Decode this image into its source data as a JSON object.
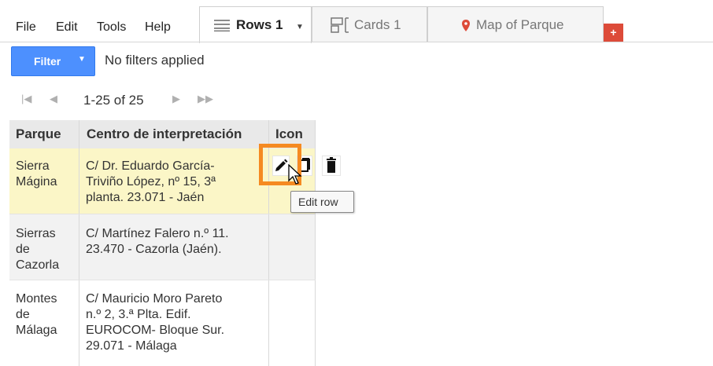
{
  "menu": {
    "file": "File",
    "edit": "Edit",
    "tools": "Tools",
    "help": "Help"
  },
  "tabs": [
    {
      "label": "Rows 1",
      "icon": "rows-icon",
      "active": true
    },
    {
      "label": "Cards 1",
      "icon": "cards-icon",
      "active": false
    },
    {
      "label": "Map of Parque",
      "icon": "map-pin-icon",
      "active": false
    }
  ],
  "add_tab_label": "+",
  "filter": {
    "button_label": "Filter",
    "status": "No filters applied"
  },
  "pagination": {
    "range": "1-25 of 25"
  },
  "table": {
    "headers": [
      "Parque",
      "Centro de interpretación",
      "Icon"
    ],
    "rows": [
      {
        "parque": [
          "Sierra",
          "Mágina"
        ],
        "centro": [
          "C/ Dr. Eduardo García-",
          "Triviño López, nº 15, 3ª",
          "planta. 23.071 - Jaén"
        ],
        "highlighted": true
      },
      {
        "parque": [
          "Sierras",
          "de",
          "Cazorla"
        ],
        "centro": [
          "C/ Martínez Falero n.º 11.",
          "23.470 - Cazorla (Jaén)."
        ],
        "highlighted": false
      },
      {
        "parque": [
          "Montes",
          "de",
          "Málaga"
        ],
        "centro": [
          "C/ Mauricio Moro Pareto",
          "n.º 2, 3.ª Plta. Edif.",
          "EUROCOM- Bloque Sur.",
          "29.071 - Málaga"
        ],
        "highlighted": false
      }
    ]
  },
  "row_actions": {
    "edit_tooltip": "Edit row"
  },
  "colors": {
    "accent": "#4d90fe",
    "highlight_border": "#f58a21",
    "row_highlight": "#fbf6c7",
    "add_tab": "#dd4b39"
  }
}
